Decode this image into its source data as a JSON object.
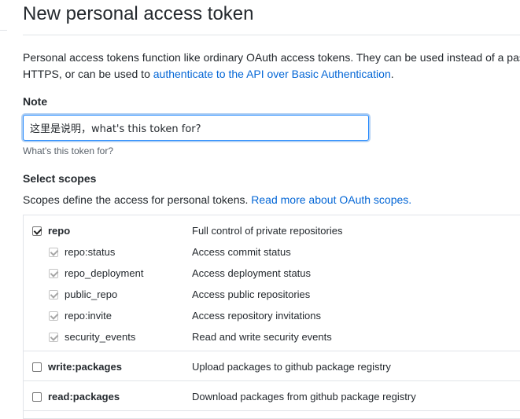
{
  "page": {
    "title": "New personal access token",
    "intro_text": "Personal access tokens function like ordinary OAuth access tokens. They can be used instead of a passw",
    "intro_line2_prefix": "HTTPS, or can be used to ",
    "intro_link": "authenticate to the API over Basic Authentication",
    "intro_line2_suffix": "."
  },
  "note": {
    "label": "Note",
    "value": "这里是说明，what's this token for?",
    "hint": "What's this token for?"
  },
  "scopes": {
    "label": "Select scopes",
    "description_prefix": "Scopes define the access for personal tokens. ",
    "description_link": "Read more about OAuth scopes.",
    "items": [
      {
        "name": "repo",
        "description": "Full control of private repositories",
        "checked": true,
        "parent": true
      },
      {
        "name": "repo:status",
        "description": "Access commit status",
        "checked": true,
        "parent": false
      },
      {
        "name": "repo_deployment",
        "description": "Access deployment status",
        "checked": true,
        "parent": false
      },
      {
        "name": "public_repo",
        "description": "Access public repositories",
        "checked": true,
        "parent": false
      },
      {
        "name": "repo:invite",
        "description": "Access repository invitations",
        "checked": true,
        "parent": false
      },
      {
        "name": "security_events",
        "description": "Read and write security events",
        "checked": true,
        "parent": false
      },
      {
        "name": "write:packages",
        "description": "Upload packages to github package registry",
        "checked": false,
        "parent": true
      },
      {
        "name": "read:packages",
        "description": "Download packages from github package registry",
        "checked": false,
        "parent": true
      }
    ]
  },
  "colors": {
    "link": "#0366d6",
    "text": "#24292e",
    "muted": "#586069",
    "border": "#e1e4e8",
    "focus": "#2188ff"
  }
}
